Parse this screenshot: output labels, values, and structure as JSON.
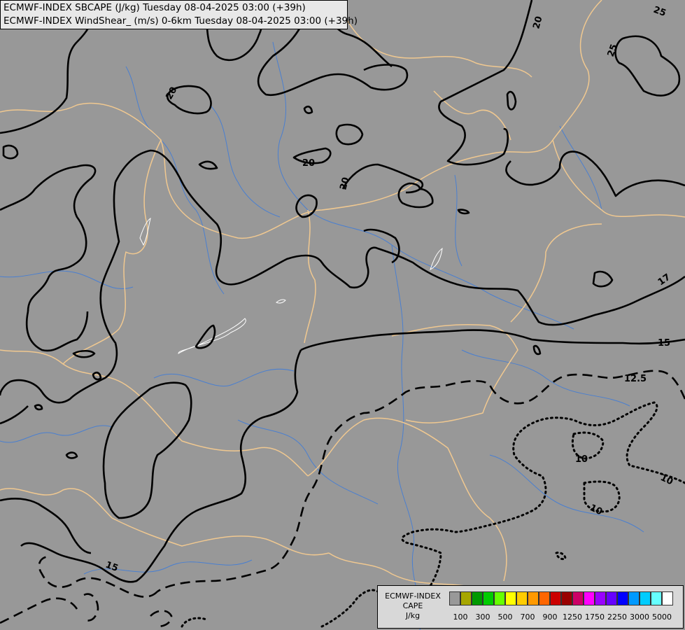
{
  "title": {
    "line1": "ECMWF-INDEX SBCAPE (J/kg) Tuesday 08-04-2025 03:00 (+39h)",
    "line2": "ECMWF-INDEX WindShear_ (m/s) 0-6km Tuesday 08-04-2025 03:00 (+39h)"
  },
  "contour_labels": [
    "20",
    "25",
    "25",
    "20",
    "20",
    "20",
    "17",
    "15",
    "12.5",
    "10",
    "10",
    "10",
    "15"
  ],
  "legend": {
    "title_line1": "ECMWF-INDEX",
    "title_line2": "CAPE",
    "title_line3": "J/kg",
    "colors": [
      "#999999",
      "#a6a600",
      "#009900",
      "#00cc00",
      "#66ff00",
      "#ffff00",
      "#ffcc00",
      "#ff9900",
      "#ff6600",
      "#cc0000",
      "#990000",
      "#cc0066",
      "#ff00ff",
      "#9900ff",
      "#6600ff",
      "#0000ff",
      "#0099ff",
      "#00ccff",
      "#66ffff",
      "#ffffff"
    ],
    "tick_labels": [
      "100",
      "300",
      "500",
      "700",
      "900",
      "1250",
      "1750",
      "2250",
      "3000",
      "5000"
    ]
  },
  "colors": {
    "background": "#989898",
    "borders": "#f0c890",
    "rivers": "#4a7fd0",
    "contours": "#000000"
  }
}
